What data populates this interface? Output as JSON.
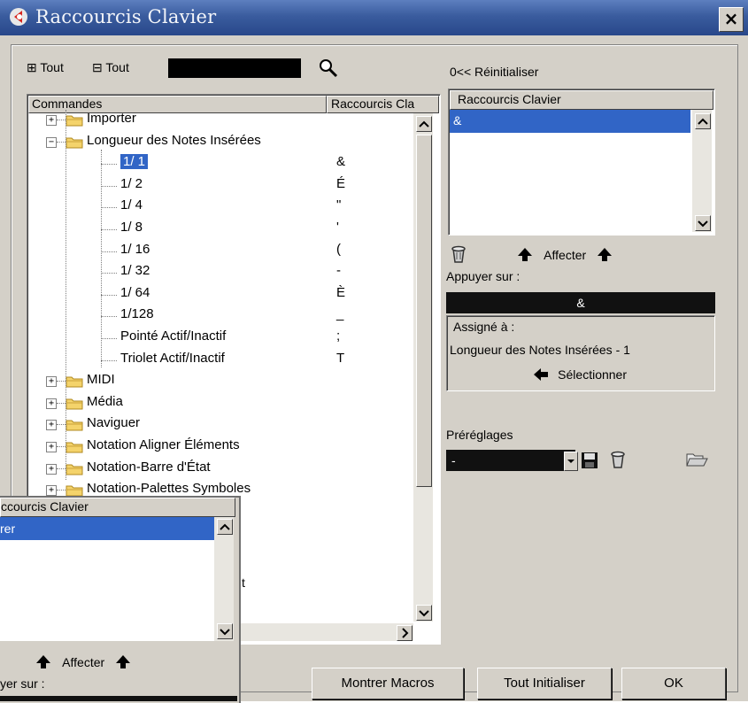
{
  "window": {
    "title": "Raccourcis Clavier",
    "close_label": "×"
  },
  "toolbar": {
    "expand_all": "Tout",
    "collapse_all": "Tout",
    "expand_symbol": "⊞",
    "collapse_symbol": "⊟",
    "search_value": "",
    "reset_label": "Réinitialiser",
    "reset_prefix": "0<<"
  },
  "tree": {
    "col_commands": "Commandes",
    "col_shortcuts": "Raccourcis Cla",
    "rows": [
      {
        "label": "Importer",
        "shortcut": "",
        "type": "folder",
        "expanded": false
      },
      {
        "label": "Longueur des Notes Insérées",
        "shortcut": "",
        "type": "folder",
        "expanded": true
      },
      {
        "label": "1/ 1",
        "shortcut": "&",
        "type": "item",
        "selected": true
      },
      {
        "label": "1/ 2",
        "shortcut": "É",
        "type": "item"
      },
      {
        "label": "1/ 4",
        "shortcut": "\"",
        "type": "item"
      },
      {
        "label": "1/ 8",
        "shortcut": "'",
        "type": "item"
      },
      {
        "label": "1/ 16",
        "shortcut": "(",
        "type": "item"
      },
      {
        "label": "1/ 32",
        "shortcut": "-",
        "type": "item"
      },
      {
        "label": "1/ 64",
        "shortcut": "È",
        "type": "item"
      },
      {
        "label": "1/128",
        "shortcut": "_",
        "type": "item"
      },
      {
        "label": "Pointé Actif/Inactif",
        "shortcut": ";",
        "type": "item"
      },
      {
        "label": "Triolet Actif/Inactif",
        "shortcut": "T",
        "type": "item"
      },
      {
        "label": "MIDI",
        "shortcut": "",
        "type": "folder",
        "expanded": false
      },
      {
        "label": "Média",
        "shortcut": "",
        "type": "folder",
        "expanded": false
      },
      {
        "label": "Naviguer",
        "shortcut": "",
        "type": "folder",
        "expanded": false
      },
      {
        "label": "Notation Aligner Éléments",
        "shortcut": "",
        "type": "folder",
        "expanded": false
      },
      {
        "label": "Notation-Barre d'État",
        "shortcut": "",
        "type": "folder",
        "expanded": false
      },
      {
        "label": "Notation-Palettes Symboles",
        "shortcut": "",
        "type": "folder",
        "expanded": false
      }
    ],
    "hidden_fragment": "t"
  },
  "shortcuts_panel": {
    "header": "Raccourcis Clavier",
    "items": [
      "&"
    ],
    "assign_label": "Affecter",
    "press_label": "Appuyer sur :",
    "press_value": "&",
    "assigned_label": "Assigné à :",
    "assigned_value": "Longueur des Notes Insérées - 1",
    "select_label": "Sélectionner"
  },
  "presets": {
    "label": "Préréglages",
    "value": "-"
  },
  "buttons": {
    "macros": "Montrer Macros",
    "init_all": "Tout Initialiser",
    "ok": "OK"
  },
  "overlay": {
    "header": "ccourcis Clavier",
    "selected_item": "rer",
    "assign_label": "Affecter",
    "press_label": "yer sur :"
  },
  "colors": {
    "selection": "#3165c6",
    "title_bar": "#3a5c9e",
    "face": "#d4d0c8"
  }
}
